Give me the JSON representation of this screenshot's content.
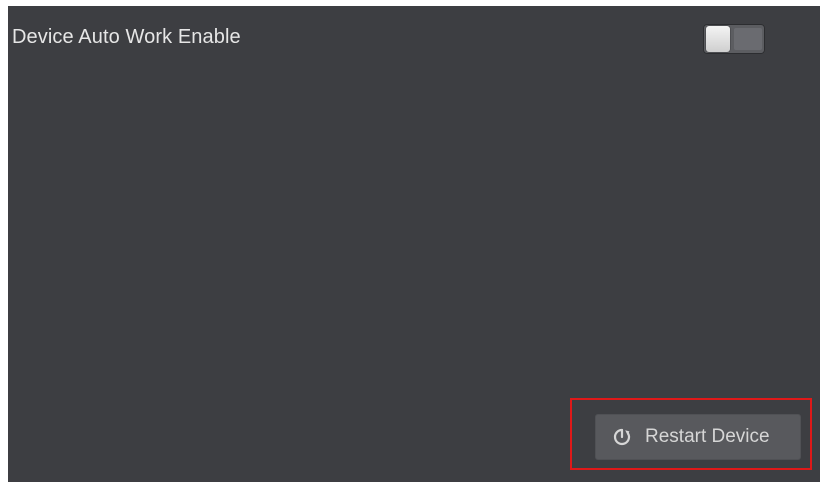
{
  "settings": {
    "auto_work_label": "Device Auto Work Enable",
    "auto_work_enabled": false
  },
  "actions": {
    "restart_label": "Restart Device",
    "restart_icon": "power-restart-icon"
  },
  "colors": {
    "panel_bg": "#3d3e42",
    "highlight": "#e01919",
    "button_bg": "#58595d"
  }
}
